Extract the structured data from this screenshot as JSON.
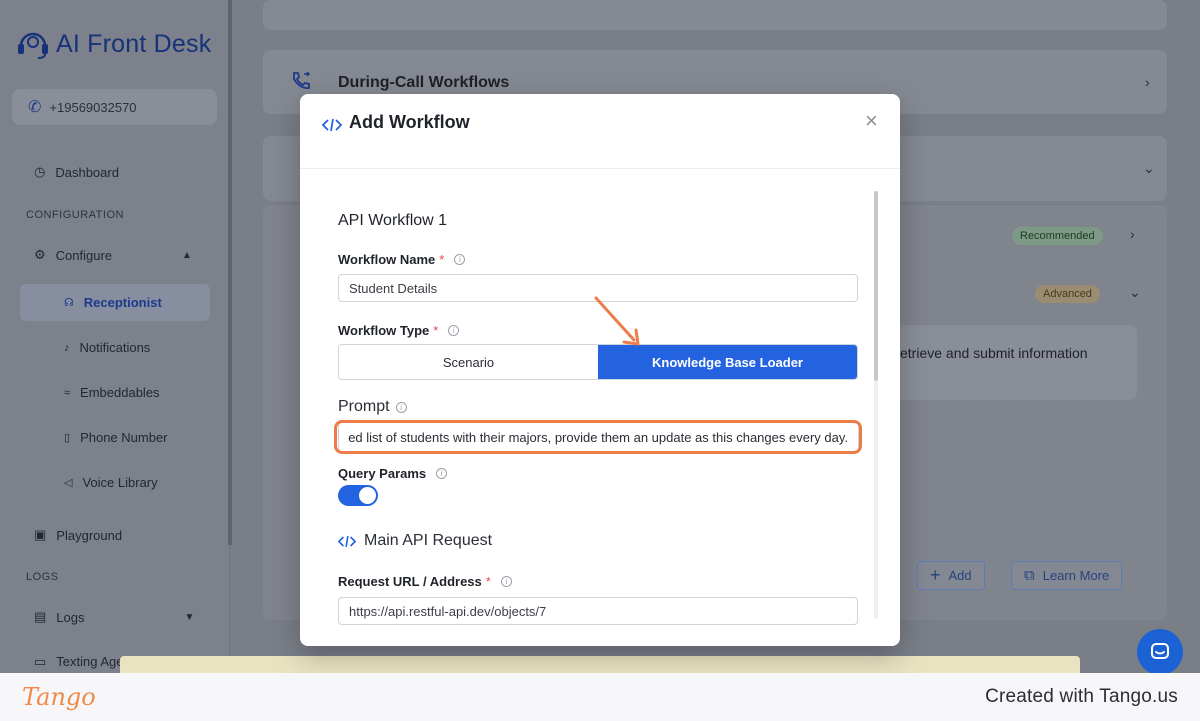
{
  "app": {
    "name": "AI Front Desk",
    "phone": "+19569032570"
  },
  "sidebar": {
    "dashboard": "Dashboard",
    "config_heading": "CONFIGURATION",
    "configure": "Configure",
    "sub_items": [
      {
        "label": "Receptionist",
        "icon": "receptionist-icon"
      },
      {
        "label": "Notifications",
        "icon": "bell-icon"
      },
      {
        "label": "Embeddables",
        "icon": "embed-icon"
      },
      {
        "label": "Phone Number",
        "icon": "phone-icon"
      },
      {
        "label": "Voice Library",
        "icon": "speaker-icon"
      }
    ],
    "playground": "Playground",
    "logs_heading": "LOGS",
    "logs": "Logs",
    "texting": "Texting Age"
  },
  "main": {
    "during_call": "During-Call Workflows",
    "badge_recommended": "Recommended",
    "badge_advanced": "Advanced",
    "bg_text": "etrieve and submit information",
    "add_label": "Add",
    "learn_more": "Learn More"
  },
  "modal": {
    "title": "Add Workflow",
    "section_title": "API Workflow 1",
    "workflow_name_label": "Workflow Name",
    "workflow_name_value": "Student Details",
    "workflow_type_label": "Workflow Type",
    "type_options": [
      "Scenario",
      "Knowledge Base Loader"
    ],
    "selected_type": "Knowledge Base Loader",
    "prompt_label": "Prompt",
    "prompt_value": "ed list of students with their majors, provide them an update as this changes every day.",
    "query_params_label": "Query Params",
    "query_params_enabled": true,
    "api_section": "Main API Request",
    "request_url_label": "Request URL / Address",
    "request_url_value": "https://api.restful-api.dev/objects/7"
  },
  "footer": {
    "brand": "Tango",
    "credit": "Created with Tango.us"
  },
  "colors": {
    "accent": "#2463e0",
    "annotation": "#ee7c4a",
    "brand_dark": "#16327a"
  }
}
